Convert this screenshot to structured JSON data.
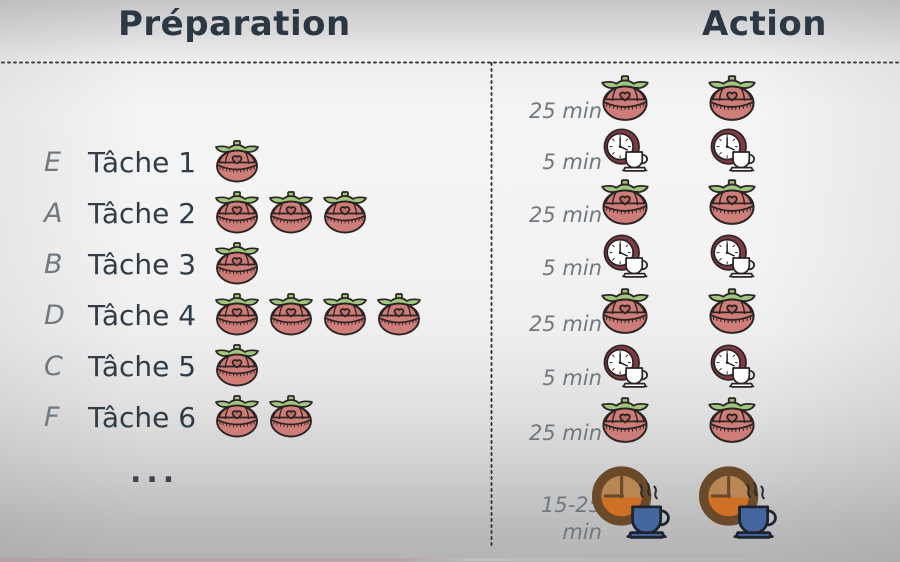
{
  "headers": {
    "preparation": "Préparation",
    "action": "Action"
  },
  "colors": {
    "header_text": "#2b3844",
    "task_letter": "#6f7880",
    "task_label": "#2f3b46",
    "time_text": "#70787f",
    "tomato_body": "#cf7d79",
    "tomato_body_dark": "#b96f6c",
    "tomato_outline": "#2c2422",
    "tomato_stem": "#9fc87e",
    "clock_rim": "#7d3b45",
    "clock_face": "#ffffff",
    "cup_white": "#fdfdfd",
    "long_clock_rim": "#6b4a2a",
    "long_clock_face_top": "#b98756",
    "long_clock_face_bottom": "#cf7124",
    "long_cup_blue": "#44679f",
    "divider_dots": "#3a3a3a",
    "background_light": "#f4f4f4",
    "background_gray": "#b3b3b4"
  },
  "tasks": [
    {
      "letter": "E",
      "label": "Tâche 1",
      "pomodoros": 1
    },
    {
      "letter": "A",
      "label": "Tâche 2",
      "pomodoros": 3
    },
    {
      "letter": "B",
      "label": "Tâche 3",
      "pomodoros": 1
    },
    {
      "letter": "D",
      "label": "Tâche 4",
      "pomodoros": 4
    },
    {
      "letter": "C",
      "label": "Tâche 5",
      "pomodoros": 1
    },
    {
      "letter": "F",
      "label": "Tâche 6",
      "pomodoros": 2
    }
  ],
  "more_indicator": "...",
  "schedule": [
    {
      "time": "25 min",
      "icon": "tomato-timer-icon"
    },
    {
      "time": "5 min",
      "icon": "clock-coffee-break-icon"
    },
    {
      "time": "25 min",
      "icon": "tomato-timer-icon"
    },
    {
      "time": "5 min",
      "icon": "clock-coffee-break-icon"
    },
    {
      "time": "25 min",
      "icon": "tomato-timer-icon"
    },
    {
      "time": "5 min",
      "icon": "clock-coffee-break-icon"
    },
    {
      "time": "25 min",
      "icon": "tomato-timer-icon"
    },
    {
      "time": "15-25\nmin",
      "time_line1": "15-25",
      "time_line2": "min",
      "icon": "long-break-clock-coffee-icon"
    }
  ]
}
